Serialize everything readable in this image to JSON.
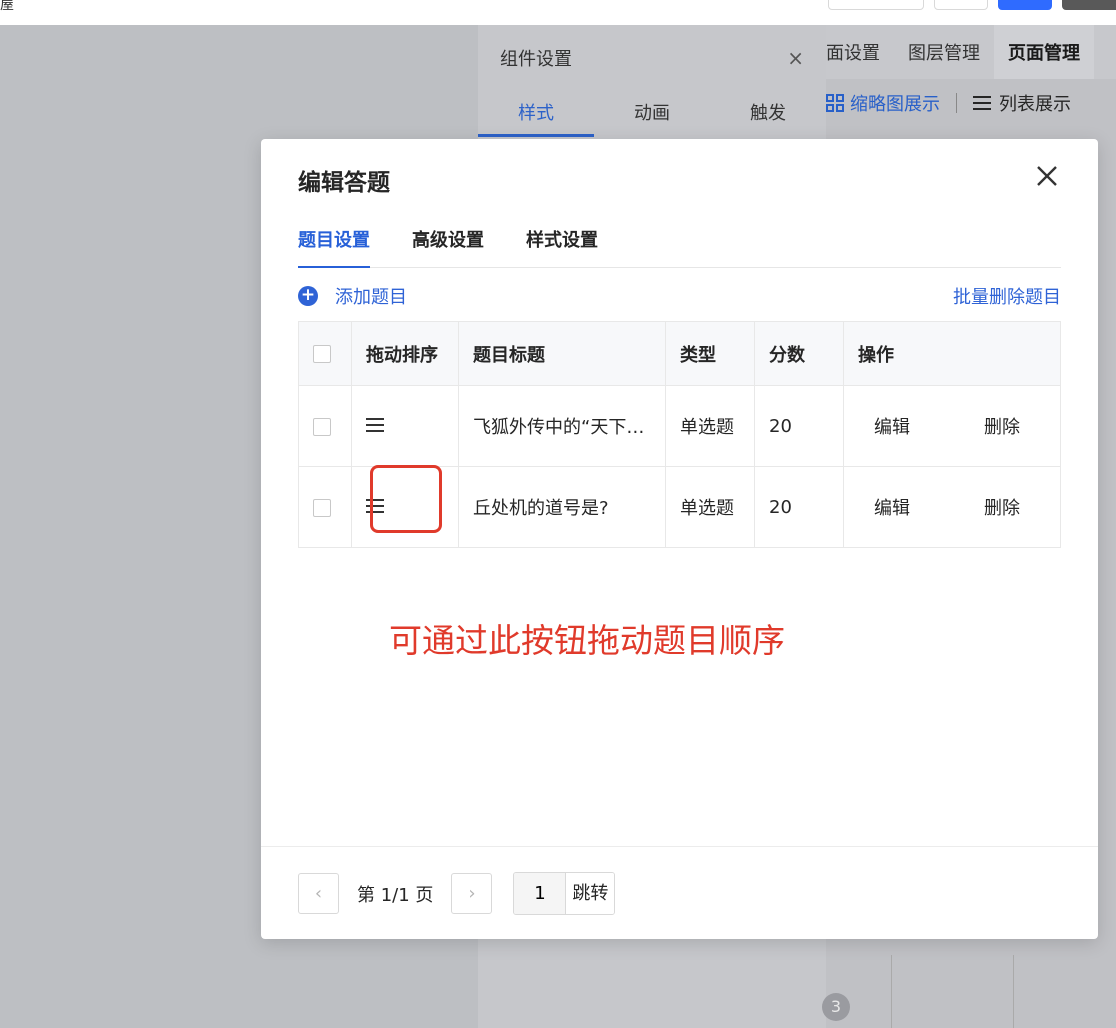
{
  "topbar": {
    "corner_text": "屋"
  },
  "right_panel": {
    "tabs": [
      "面设置",
      "图层管理",
      "页面管理"
    ],
    "active_tab": "页面管理",
    "thumbnail_view_label": "缩略图展示",
    "list_view_label": "列表展示"
  },
  "component_panel": {
    "title": "组件设置",
    "tabs": [
      "样式",
      "动画",
      "触发"
    ],
    "active_tab": "样式",
    "page_badge": "3"
  },
  "modal": {
    "title": "编辑答题",
    "tabs": [
      "题目设置",
      "高级设置",
      "样式设置"
    ],
    "active_tab": "题目设置",
    "add_question_label": "添加题目",
    "batch_delete_label": "批量删除题目",
    "table": {
      "headers": [
        "拖动排序",
        "题目标题",
        "类型",
        "分数",
        "操作"
      ],
      "rows": [
        {
          "title": "飞狐外传中的“天下…",
          "type": "单选题",
          "score": "20",
          "edit": "编辑",
          "delete": "删除"
        },
        {
          "title": "丘处机的道号是?",
          "type": "单选题",
          "score": "20",
          "edit": "编辑",
          "delete": "删除"
        }
      ]
    },
    "annotation": "可通过此按钮拖动题目顺序",
    "pagination": {
      "prev": "‹",
      "next": "›",
      "page_info": "第 1/1 页",
      "jump_value": "1",
      "jump_label": "跳转"
    }
  },
  "colors": {
    "accent_blue": "#2f63d6",
    "annotation_red": "#e03a2b",
    "overlay_gray": "#bdbfc3"
  }
}
